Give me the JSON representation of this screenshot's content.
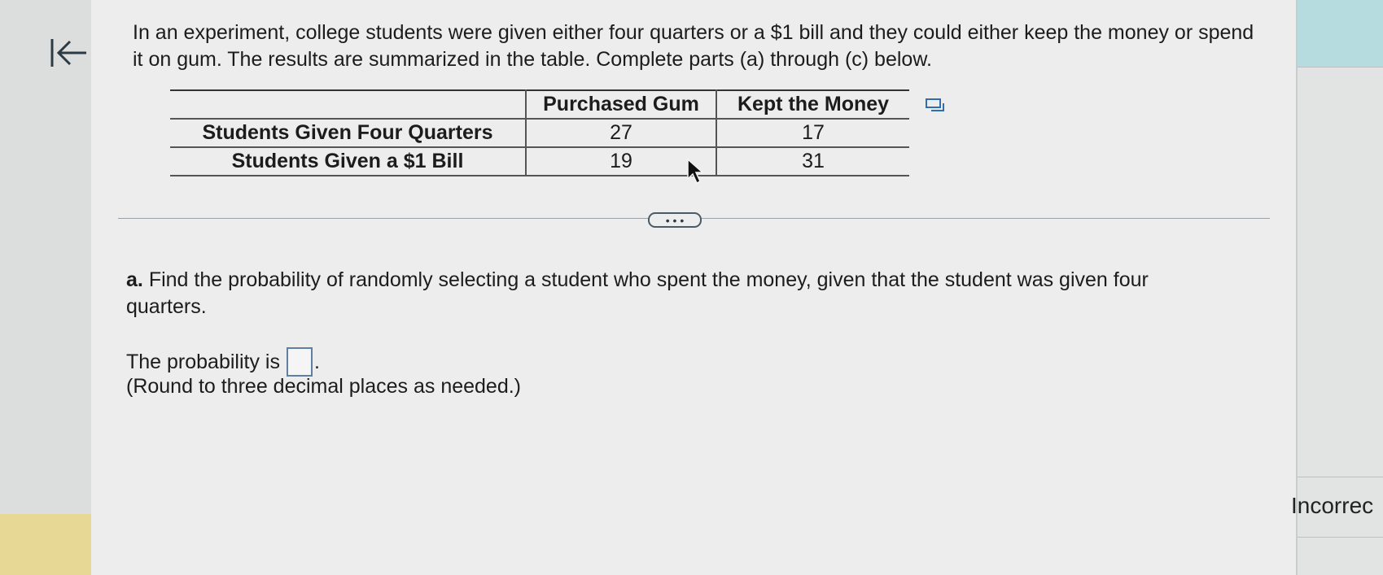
{
  "question": {
    "intro": "In an experiment, college students were given either four quarters or a $1 bill and they could either keep the money or spend it on gum. The results are summarized in the table. Complete parts (a) through (c) below."
  },
  "table": {
    "columns": [
      "Purchased Gum",
      "Kept the Money"
    ],
    "rows": [
      {
        "label": "Students Given Four Quarters",
        "values": [
          "27",
          "17"
        ]
      },
      {
        "label": "Students Given a $1 Bill",
        "values": [
          "19",
          "31"
        ]
      }
    ]
  },
  "more_button": {
    "label": "• • •"
  },
  "part_a": {
    "letter": "a.",
    "question": "Find the probability of randomly selecting a student who spent the money, given that the student was given four quarters.",
    "answer_prefix": "The probability is",
    "answer_value": "",
    "answer_suffix": ".",
    "round_note": "(Round to three decimal places as needed.)"
  },
  "side_status": "Incorrec",
  "icons": [
    "back-arrow-icon",
    "copy-icon",
    "mouse-cursor-icon"
  ]
}
